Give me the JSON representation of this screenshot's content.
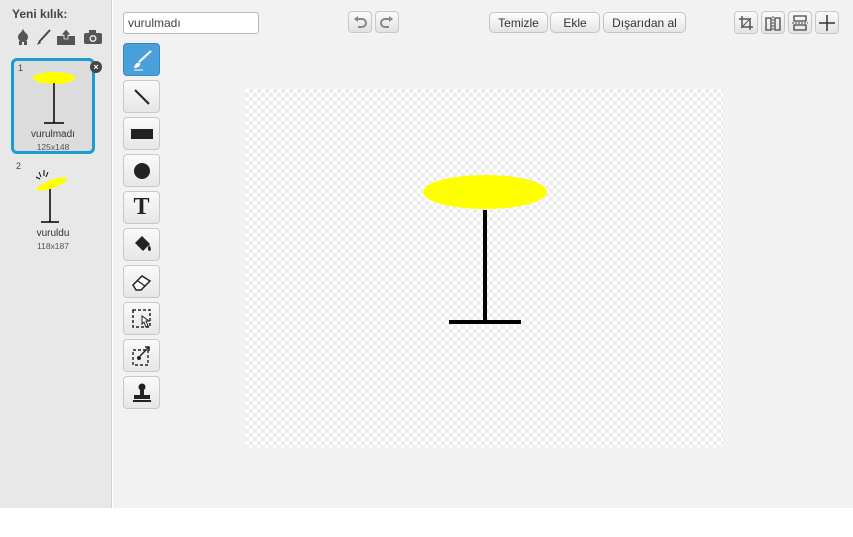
{
  "costumes_panel": {
    "new_costume_label": "Yeni kılık:",
    "new_icons": [
      "sprite-library-icon",
      "paint-brush-icon",
      "upload-icon",
      "camera-icon"
    ],
    "items": [
      {
        "number": "1",
        "name": "vurulmadı",
        "size": "125x148",
        "selected": true
      },
      {
        "number": "2",
        "name": "vuruldu",
        "size": "118x187",
        "selected": false
      }
    ]
  },
  "editor": {
    "costume_name_value": "vurulmadı",
    "undo_icon": "undo-icon",
    "redo_icon": "redo-icon",
    "buttons": {
      "clear": "Temizle",
      "add": "Ekle",
      "import": "Dışarıdan al"
    },
    "top_right_icons": [
      "set-center-icon",
      "flip-horizontal-icon",
      "flip-vertical-icon",
      "crosshair-icon"
    ],
    "tools": [
      "brush-icon",
      "line-icon",
      "rectangle-icon",
      "ellipse-icon",
      "text-icon",
      "fill-icon",
      "eraser-icon",
      "select-icon",
      "select-duplicate-icon",
      "stamp-icon"
    ],
    "active_tool": "brush-icon",
    "text_tool_glyph": "T"
  },
  "colors": {
    "accent": "#1c9ad6",
    "costume_fill": "#ffff00",
    "stroke": "#000000"
  }
}
